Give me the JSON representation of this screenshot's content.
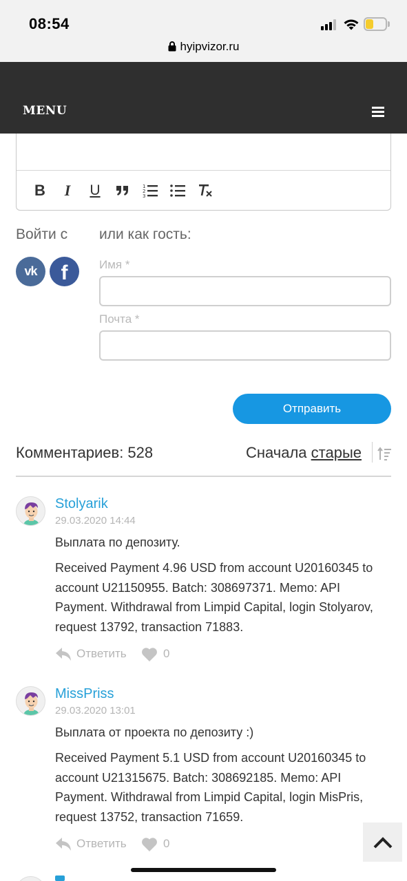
{
  "status_bar": {
    "time": "08:54",
    "url": "hyipvizor.ru"
  },
  "menu": {
    "label": "MENU"
  },
  "editor": {
    "toolbar": {
      "bold": "B",
      "italic": "I",
      "underline": "U",
      "quote": "”"
    }
  },
  "auth": {
    "login_with": "Войти с",
    "guest_label": "или как гость:",
    "name_label": "Имя *",
    "email_label": "Почта *",
    "name_value": "",
    "email_value": "",
    "submit": "Отправить"
  },
  "comments_header": {
    "count_text": "Комментариев: 528",
    "sort_prefix": "Сначала",
    "sort_value": "старые"
  },
  "comments": [
    {
      "author": "Stolyarik",
      "date": "29.03.2020 14:44",
      "title": "Выплата по депозиту.",
      "body": "Received Payment 4.96 USD from account U20160345 to account U21150955. Batch: 308697371. Memo: API Payment. Withdrawal from Limpid Capital, login Stolyarov, request 13792, transaction 71883.",
      "reply": "Ответить",
      "likes": "0"
    },
    {
      "author": "MissPriss",
      "date": "29.03.2020 13:01",
      "title": "Выплата от проекта по депозиту :)",
      "body": "Received Payment 5.1 USD from account U20160345 to account U21315675. Batch: 308692185. Memo: API Payment. Withdrawal from Limpid Capital, login MisPris, request 13752, transaction 71659.",
      "reply": "Ответить",
      "likes": "0"
    }
  ],
  "colors": {
    "menu_bg": "#2f2f2f",
    "accent_blue": "#1797e2",
    "author_link": "#27a0d8",
    "muted": "#b5b5b5",
    "battery": "#f5cc2d"
  },
  "icons": [
    "lock-icon",
    "signal-icon",
    "wifi-icon",
    "battery-icon",
    "hamburger-icon",
    "vk-icon",
    "facebook-icon",
    "reply-icon",
    "heart-icon",
    "sort-icon",
    "chevron-up-icon"
  ]
}
